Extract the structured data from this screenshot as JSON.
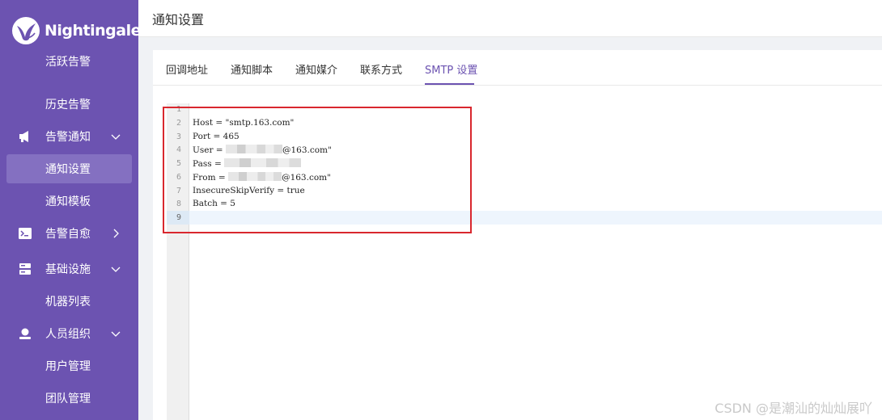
{
  "sidebar": {
    "brand": "Nightingale",
    "menu": [
      {
        "label": "活跃告警",
        "type": "sub",
        "clipped": true
      },
      {
        "label": "历史告警",
        "type": "sub"
      },
      {
        "label": "告警通知",
        "type": "group",
        "icon": "megaphone-icon",
        "chevron": "down"
      },
      {
        "label": "通知设置",
        "type": "sub",
        "active": true
      },
      {
        "label": "通知模板",
        "type": "sub"
      },
      {
        "label": "告警自愈",
        "type": "group",
        "icon": "terminal-icon",
        "chevron": "right"
      },
      {
        "label": "基础设施",
        "type": "group",
        "icon": "server-icon",
        "chevron": "down"
      },
      {
        "label": "机器列表",
        "type": "sub"
      },
      {
        "label": "人员组织",
        "type": "group",
        "icon": "user-icon",
        "chevron": "down"
      },
      {
        "label": "用户管理",
        "type": "sub"
      },
      {
        "label": "团队管理",
        "type": "sub"
      }
    ]
  },
  "header": {
    "title": "通知设置"
  },
  "tabs": [
    {
      "label": "回调地址"
    },
    {
      "label": "通知脚本"
    },
    {
      "label": "通知媒介"
    },
    {
      "label": "联系方式"
    },
    {
      "label": "SMTP 设置",
      "active": true
    }
  ],
  "editor": {
    "line_numbers": [
      "1",
      "2",
      "3",
      "4",
      "5",
      "6",
      "7",
      "8",
      "9"
    ],
    "lines": [
      {
        "text": ""
      },
      {
        "text": "Host = \"smtp.163.com\""
      },
      {
        "text": "Port = 465"
      },
      {
        "pre": "User = ",
        "post": "@163.com\"",
        "redacted": true
      },
      {
        "pre": "Pass = ",
        "post": "",
        "redacted": true
      },
      {
        "pre": "From = ",
        "post": "@163.com\"",
        "redacted": true
      },
      {
        "text": "InsecureSkipVerify = true"
      },
      {
        "text": "Batch = 5"
      },
      {
        "text": ""
      }
    ],
    "active_line": 9
  },
  "watermark": "CSDN @是潮汕的灿灿展吖",
  "colors": {
    "sidebar": "#6c53b1",
    "accent": "#6c53b1",
    "highlight_box": "#d9272e"
  }
}
